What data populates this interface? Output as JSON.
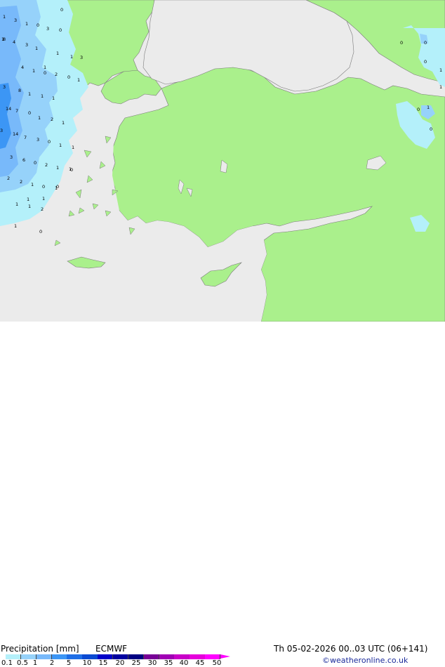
{
  "title": "Precipitation [mm]",
  "model": "ECMWF",
  "valid_time": "Th 05-02-2026 00..03 UTC (06+141)",
  "credit": "©weatheronline.co.uk",
  "legend": {
    "ticks": [
      "0.1",
      "0.5",
      "1",
      "2",
      "5",
      "10",
      "15",
      "20",
      "25",
      "30",
      "35",
      "40",
      "45",
      "50"
    ],
    "colors": [
      "#b4f0fa",
      "#96d2fa",
      "#78b9fa",
      "#3c96f5",
      "#1e6ee6",
      "#0a4ad2",
      "#0000c8",
      "#0000a0",
      "#000082",
      "#780096",
      "#a000b4",
      "#c800c8",
      "#e600dc",
      "#ff00ff"
    ]
  },
  "colors": {
    "land": "#aaf08c",
    "sea": "#ebebeb",
    "precip_light": "#b4f0fa",
    "precip_mid": "#96d2fa",
    "precip_heavy": "#78b9fa",
    "coast": "#7a7a7a"
  },
  "precip_labels": [
    {
      "t": "1"
    },
    {
      "t": "3"
    },
    {
      "t": "1"
    },
    {
      "t": "0"
    },
    {
      "t": "3"
    },
    {
      "t": "0"
    },
    {
      "t": "0"
    },
    {
      "t": "1"
    },
    {
      "t": "8"
    },
    {
      "t": "4"
    },
    {
      "t": "3"
    },
    {
      "t": "1"
    },
    {
      "t": "1"
    },
    {
      "t": "1"
    },
    {
      "t": "3"
    },
    {
      "t": "1"
    },
    {
      "t": "4"
    },
    {
      "t": "1"
    },
    {
      "t": "0"
    },
    {
      "t": "2"
    },
    {
      "t": "0"
    },
    {
      "t": "1"
    },
    {
      "t": "3"
    },
    {
      "t": "8"
    },
    {
      "t": "1"
    },
    {
      "t": "1"
    },
    {
      "t": "1"
    },
    {
      "t": "14"
    },
    {
      "t": "7"
    },
    {
      "t": "0"
    },
    {
      "t": "1"
    },
    {
      "t": "2"
    },
    {
      "t": "1"
    },
    {
      "t": "3"
    },
    {
      "t": "14"
    },
    {
      "t": "7"
    },
    {
      "t": "3"
    },
    {
      "t": "0"
    },
    {
      "t": "1"
    },
    {
      "t": "1"
    },
    {
      "t": "3"
    },
    {
      "t": "6"
    },
    {
      "t": "0"
    },
    {
      "t": "2"
    },
    {
      "t": "1"
    },
    {
      "t": "1"
    },
    {
      "t": "2"
    },
    {
      "t": "2"
    },
    {
      "t": "1"
    },
    {
      "t": "0"
    },
    {
      "t": "1"
    },
    {
      "t": "1"
    },
    {
      "t": "1"
    },
    {
      "t": "2"
    },
    {
      "t": "1"
    },
    {
      "t": "0"
    },
    {
      "t": "0"
    },
    {
      "t": "0"
    },
    {
      "t": "0"
    },
    {
      "t": "1"
    },
    {
      "t": "0"
    },
    {
      "t": "1"
    },
    {
      "t": "0"
    },
    {
      "t": "1"
    },
    {
      "t": "1"
    },
    {
      "t": "1"
    },
    {
      "t": "0"
    },
    {
      "t": "0"
    }
  ]
}
